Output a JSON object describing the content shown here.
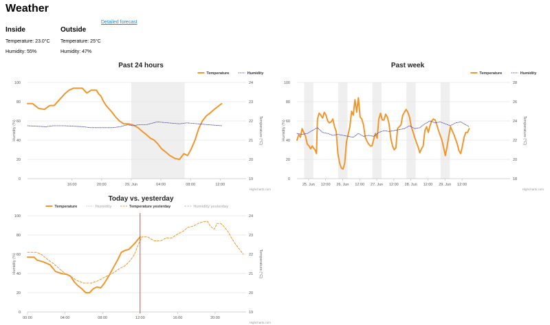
{
  "page": {
    "title": "Weather",
    "forecast_link": "Detailed forecast"
  },
  "inside": {
    "heading": "Inside",
    "temperature": "Temperature: 23.0°C",
    "humidity": "Humidity: 55%"
  },
  "outside": {
    "heading": "Outside",
    "temperature": "Temperature: 25°C",
    "humidity": "Humidity: 47%"
  },
  "colors": {
    "temperature": "#f0962c",
    "humidity": "#3f3f9f",
    "band": "#efefef",
    "now_line": "#e0341a"
  },
  "credit": "Highcharts.com",
  "chart_data": [
    {
      "id": "past24",
      "type": "line",
      "title": "Past 24 hours",
      "ylabel": "Humidity (%)",
      "y2label": "Temperature (°C)",
      "ylim": [
        0,
        100
      ],
      "y2lim": [
        19,
        24
      ],
      "yticks": [
        "0",
        "20",
        "40",
        "60",
        "80",
        "100"
      ],
      "y2ticks": [
        "19",
        "20",
        "21",
        "22",
        "23",
        "24"
      ],
      "xlim": [
        0,
        29.5
      ],
      "xticks": [
        {
          "x": 6,
          "label": "16:00"
        },
        {
          "x": 10,
          "label": "20:00"
        },
        {
          "x": 14,
          "label": "29. Jun"
        },
        {
          "x": 18,
          "label": "04:00"
        },
        {
          "x": 22,
          "label": "08:00"
        },
        {
          "x": 26,
          "label": "12:00"
        }
      ],
      "bands": [
        [
          14,
          21.2
        ]
      ],
      "legend": "top-right",
      "series": [
        {
          "name": "Temperature",
          "axis": "y2",
          "style": "solid",
          "width": 2,
          "x": [
            0,
            0.7,
            1.5,
            2.3,
            3,
            3.6,
            4.3,
            5,
            5.6,
            6.2,
            6.9,
            7.4,
            8,
            8.6,
            9.3,
            9.6,
            9.9,
            10.2,
            10.6,
            11.3,
            11.9,
            12.4,
            13,
            13.6,
            14.2,
            14.9,
            15.5,
            16,
            16.6,
            17.1,
            17.6,
            18.1,
            18.6,
            19.2,
            19.9,
            20.5,
            21.1,
            21.6,
            22.1,
            22.6,
            23.1,
            23.6,
            24.1,
            24.6,
            25.2,
            25.7,
            26.2
          ],
          "y": [
            22.9,
            22.9,
            22.65,
            22.6,
            22.8,
            22.8,
            23.1,
            23.4,
            23.6,
            23.7,
            23.7,
            23.7,
            23.45,
            23.6,
            23.6,
            23.4,
            23.3,
            23.05,
            22.8,
            22.5,
            22.2,
            22.0,
            21.85,
            21.85,
            21.8,
            21.65,
            21.45,
            21.3,
            21.1,
            21.0,
            20.8,
            20.55,
            20.4,
            20.2,
            20.05,
            20.0,
            20.3,
            20.2,
            20.55,
            21.0,
            21.6,
            22.0,
            22.25,
            22.4,
            22.6,
            22.75,
            22.9
          ]
        },
        {
          "name": "Humidity",
          "axis": "y",
          "style": "dotted",
          "width": 0.8,
          "x": [
            0,
            2.5,
            3.5,
            5,
            7.5,
            8.5,
            10,
            11.5,
            12.5,
            13.5,
            14.2,
            15,
            16,
            17.5,
            19,
            20.5,
            21.5,
            23,
            24.5,
            26.2
          ],
          "y": [
            55,
            54,
            55,
            55,
            54,
            53,
            53,
            53,
            54,
            56,
            55,
            56,
            56,
            59,
            58,
            57,
            58,
            57,
            56,
            55
          ]
        }
      ]
    },
    {
      "id": "pastweek",
      "type": "line",
      "title": "Past week",
      "ylabel": "Humidity (%)",
      "y2label": "Temperature (°C)",
      "ylim": [
        0,
        100
      ],
      "y2lim": [
        18,
        28
      ],
      "yticks": [
        "0",
        "20",
        "40",
        "60",
        "80",
        "100"
      ],
      "y2ticks": [
        "18",
        "20",
        "22",
        "24",
        "26",
        "28"
      ],
      "xlim": [
        -0.15,
        6.1
      ],
      "xticks": [
        {
          "x": 0.19,
          "label": "25. Jun"
        },
        {
          "x": 0.69,
          "label": "12:00"
        },
        {
          "x": 1.19,
          "label": "26. Jun"
        },
        {
          "x": 1.69,
          "label": "12:00"
        },
        {
          "x": 2.19,
          "label": "27. Jun"
        },
        {
          "x": 2.69,
          "label": "12:00"
        },
        {
          "x": 3.19,
          "label": "28. Jun"
        },
        {
          "x": 3.69,
          "label": "12:00"
        },
        {
          "x": 4.19,
          "label": "29. Jun"
        },
        {
          "x": 4.69,
          "label": "12:00"
        }
      ],
      "bands": [
        [
          0.06,
          0.33
        ],
        [
          1.06,
          1.33
        ],
        [
          2.06,
          2.33
        ],
        [
          3.06,
          3.33
        ],
        [
          4.06,
          4.33
        ]
      ],
      "legend": "top-right",
      "series": [
        {
          "name": "Temperature",
          "axis": "y2",
          "style": "solid",
          "width": 2,
          "x": [
            -0.15,
            -0.1,
            -0.05,
            0,
            0.05,
            0.1,
            0.15,
            0.2,
            0.25,
            0.3,
            0.33,
            0.38,
            0.42,
            0.45,
            0.5,
            0.55,
            0.6,
            0.65,
            0.7,
            0.75,
            0.8,
            0.85,
            0.9,
            0.95,
            1.0,
            1.05,
            1.1,
            1.15,
            1.2,
            1.25,
            1.3,
            1.35,
            1.4,
            1.45,
            1.5,
            1.55,
            1.6,
            1.65,
            1.7,
            1.75,
            1.8,
            1.85,
            1.9,
            1.95,
            2.0,
            2.05,
            2.1,
            2.15,
            2.2,
            2.25,
            2.3,
            2.35,
            2.4,
            2.45,
            2.5,
            2.55,
            2.6,
            2.65,
            2.7,
            2.75,
            2.8,
            2.85,
            2.9,
            2.95,
            3.0,
            3.05,
            3.1,
            3.15,
            3.2,
            3.25,
            3.3,
            3.35,
            3.4,
            3.45,
            3.5,
            3.55,
            3.6,
            3.65,
            3.7,
            3.75,
            3.8,
            3.85,
            3.9,
            3.95,
            4.0,
            4.05,
            4.1,
            4.15,
            4.2,
            4.25,
            4.3,
            4.35,
            4.4,
            4.45,
            4.5,
            4.55,
            4.6,
            4.65,
            4.7,
            4.75,
            4.8,
            4.85,
            4.9
          ],
          "y": [
            22.0,
            22.6,
            22.3,
            23.2,
            22.8,
            22.4,
            21.6,
            21.4,
            21.1,
            21.4,
            21.2,
            21.0,
            20.6,
            24.2,
            24.8,
            24.6,
            24.3,
            24.9,
            24.6,
            24.0,
            23.8,
            23.9,
            24.2,
            23.4,
            22.9,
            20.6,
            19.6,
            19.1,
            19.0,
            19.6,
            21.8,
            22.6,
            23.4,
            25.0,
            24.6,
            26.2,
            24.9,
            26.4,
            24.4,
            24.2,
            23.6,
            22.3,
            21.9,
            21.6,
            21.4,
            21.4,
            22.1,
            22.7,
            22.2,
            24.2,
            24.8,
            24.1,
            24.1,
            24.7,
            24.4,
            23.7,
            22.2,
            21.4,
            21.0,
            21.2,
            23.2,
            23.4,
            23.6,
            24.6,
            24.9,
            25.2,
            24.9,
            24.4,
            23.4,
            22.9,
            22.3,
            21.8,
            21.3,
            20.7,
            21.1,
            21.4,
            23.0,
            23.4,
            22.8,
            23.5,
            24.0,
            24.2,
            24.1,
            23.6,
            23.0,
            22.5,
            22.0,
            21.2,
            20.4,
            21.3,
            22.4,
            23.4,
            23.0,
            22.6,
            22.1,
            21.6,
            20.9,
            20.6,
            21.4,
            22.3,
            22.8,
            22.8,
            23.2
          ]
        },
        {
          "name": "Humidity",
          "axis": "y",
          "style": "dotted",
          "width": 0.8,
          "x": [
            -0.15,
            0.0,
            0.15,
            0.3,
            0.45,
            0.6,
            0.75,
            0.9,
            1.05,
            1.2,
            1.35,
            1.5,
            1.65,
            1.8,
            1.95,
            2.1,
            2.25,
            2.4,
            2.55,
            2.7,
            2.85,
            3.0,
            3.15,
            3.3,
            3.45,
            3.6,
            3.75,
            3.9,
            4.05,
            4.2,
            4.35,
            4.5,
            4.65,
            4.8,
            4.9
          ],
          "y": [
            47,
            46,
            47,
            50,
            53,
            48,
            47,
            45,
            46,
            45,
            44,
            43,
            47,
            44,
            45,
            44,
            48,
            50,
            49,
            50,
            51,
            52,
            55,
            52,
            53,
            57,
            60,
            58,
            59,
            57,
            55,
            58,
            59,
            56,
            54
          ]
        }
      ]
    },
    {
      "id": "today",
      "type": "line",
      "title": "Today vs. yesterday",
      "ylabel": "Humidity (%)",
      "y2label": "Temperature (°C)",
      "ylim": [
        0,
        100
      ],
      "y2lim": [
        19,
        24
      ],
      "yticks": [
        "0",
        "20",
        "40",
        "60",
        "80",
        "100"
      ],
      "y2ticks": [
        "19",
        "20",
        "21",
        "22",
        "23",
        "24"
      ],
      "xlim": [
        0,
        23.3
      ],
      "xticks": [
        {
          "x": 0,
          "label": "00:00"
        },
        {
          "x": 4,
          "label": "04:00"
        },
        {
          "x": 8,
          "label": "08:00"
        },
        {
          "x": 12,
          "label": "12:00"
        },
        {
          "x": 16,
          "label": "16:00"
        },
        {
          "x": 20,
          "label": "20:00"
        }
      ],
      "now_x": 12,
      "legend": "top",
      "series": [
        {
          "name": "Temperature",
          "axis": "y2",
          "style": "solid",
          "width": 2,
          "x": [
            0,
            0.7,
            1,
            1.7,
            2.4,
            3,
            3.6,
            4.2,
            4.6,
            5,
            5.4,
            5.8,
            6.2,
            6.6,
            7,
            7.4,
            7.8,
            8.2,
            8.7,
            9.2,
            9.6,
            10,
            10.4,
            10.8,
            11.4,
            12
          ],
          "y": [
            21.85,
            21.85,
            21.7,
            21.6,
            21.45,
            21.1,
            21.0,
            20.95,
            20.85,
            20.55,
            20.35,
            20.2,
            20.0,
            20.0,
            20.2,
            20.3,
            20.25,
            20.5,
            20.9,
            21.35,
            21.7,
            22.1,
            22.2,
            22.25,
            22.55,
            22.9
          ]
        },
        {
          "name": "Humidity",
          "axis": "y",
          "style": "dotted",
          "width": 0.8,
          "color": "#bbbbbb",
          "x": [],
          "y": []
        },
        {
          "name": "Temperature yesterday",
          "axis": "y2",
          "style": "dashed",
          "width": 1,
          "x": [
            0,
            0.5,
            1,
            1.6,
            2.2,
            2.8,
            3.4,
            4,
            4.6,
            5.2,
            6,
            6.8,
            7.4,
            8,
            8.6,
            9.2,
            9.8,
            10.4,
            11,
            11.4,
            11.8,
            12.2,
            12.8,
            13.5,
            14.2,
            14.8,
            15.4,
            16,
            16.6,
            17.1,
            17.6,
            18.2,
            18.8,
            19.2,
            19.5,
            19.9,
            20.2,
            20.6,
            21,
            21.4,
            21.8,
            22.2,
            22.6,
            23
          ],
          "y": [
            22.1,
            22.1,
            22.1,
            21.95,
            21.7,
            21.5,
            21.25,
            21.0,
            20.85,
            20.65,
            20.5,
            20.5,
            20.6,
            20.75,
            20.9,
            21.05,
            21.25,
            21.4,
            21.7,
            22.0,
            22.5,
            22.9,
            22.9,
            22.7,
            22.7,
            22.85,
            22.85,
            23.05,
            23.2,
            23.4,
            23.45,
            23.6,
            23.7,
            23.7,
            23.45,
            23.3,
            23.6,
            23.6,
            23.4,
            23.15,
            22.8,
            22.5,
            22.25,
            22.0
          ]
        },
        {
          "name": "Humidity yesterday",
          "axis": "y",
          "style": "dashed",
          "width": 0.8,
          "color": "#bbbbbb",
          "x": [],
          "y": []
        }
      ]
    }
  ]
}
